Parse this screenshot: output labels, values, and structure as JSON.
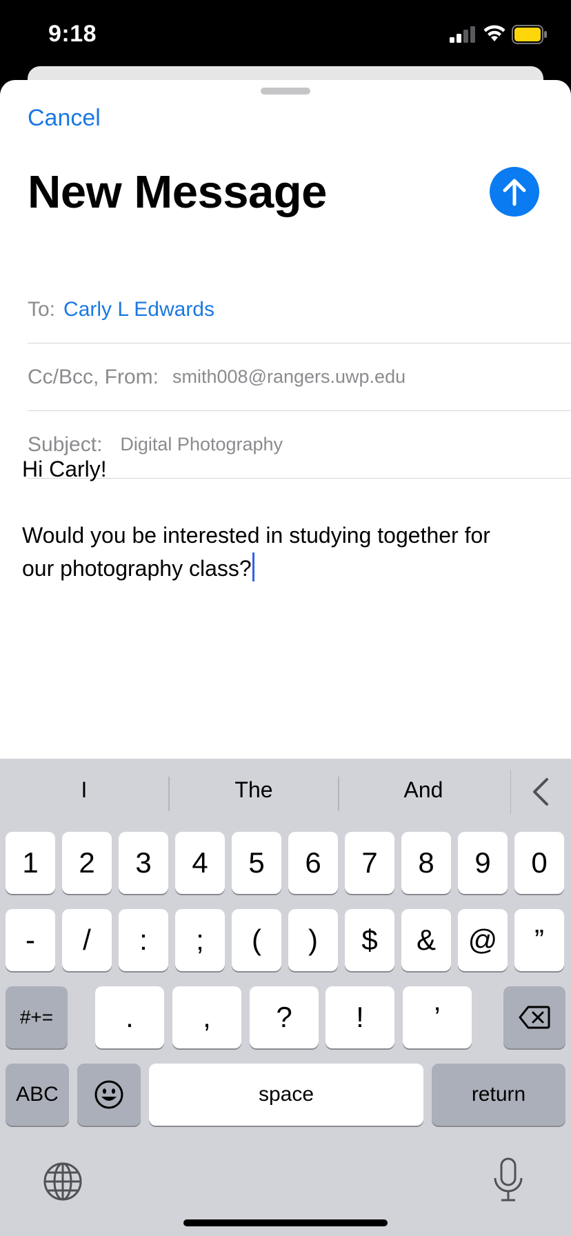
{
  "status_bar": {
    "time": "9:18",
    "signal_icon": "cellular-signal-icon",
    "wifi_icon": "wifi-icon",
    "battery_icon": "battery-icon",
    "battery_color": "#ffd60a"
  },
  "header": {
    "cancel_label": "Cancel",
    "title": "New Message",
    "send_icon": "arrow-up-icon"
  },
  "fields": {
    "to_label": "To:",
    "to_value": "Carly L Edwards",
    "cc_label": "Cc/Bcc, From:",
    "from_value": "smith008@rangers.uwp.edu",
    "subject_label": "Subject:",
    "subject_value": "Digital Photography"
  },
  "body": {
    "lines": [
      "Hi Carly!",
      "",
      "Would you be interested in studying together for",
      "our photography class?"
    ]
  },
  "keyboard": {
    "predictions": [
      "I",
      "The",
      "And"
    ],
    "row1": [
      "1",
      "2",
      "3",
      "4",
      "5",
      "6",
      "7",
      "8",
      "9",
      "0"
    ],
    "row2": [
      "-",
      "/",
      ":",
      ";",
      "(",
      ")",
      "$",
      "&",
      "@",
      "”"
    ],
    "row3_left": "#+=",
    "row3": [
      ".",
      ",",
      "?",
      "!",
      "’"
    ],
    "row4_abc": "ABC",
    "row4_space": "space",
    "row4_return": "return"
  },
  "colors": {
    "accent": "#1b78e2",
    "send_button": "#0a7bf0",
    "keyboard_bg": "#d1d3d9",
    "caret": "#2f62e8"
  }
}
